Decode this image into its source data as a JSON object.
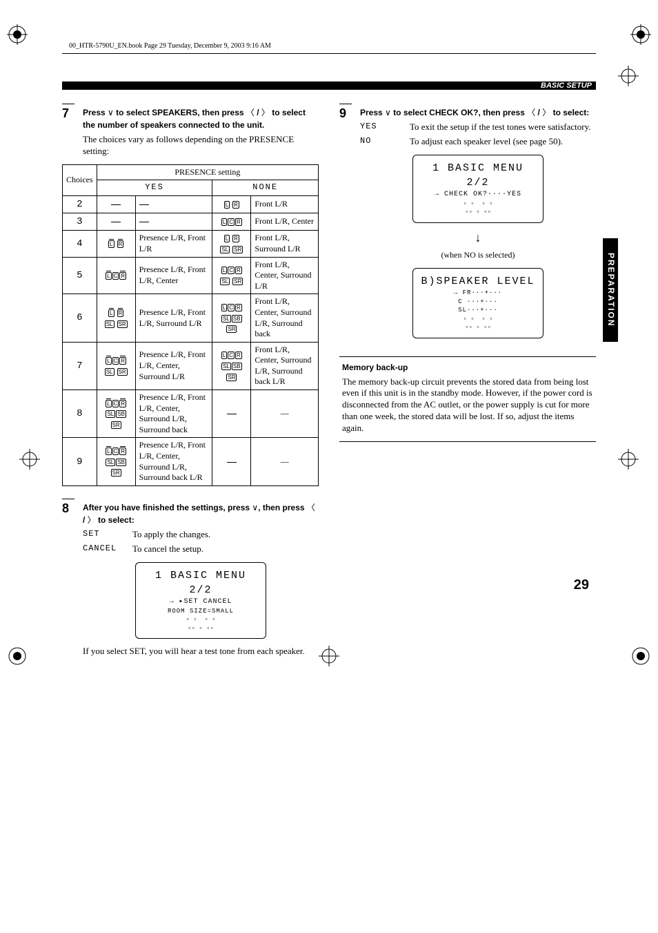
{
  "header": {
    "filepath": "00_HTR-5790U_EN.book  Page 29  Tuesday, December 9, 2003  9:16 AM",
    "section": "BASIC SETUP"
  },
  "step7": {
    "num": "7",
    "instr_parts": {
      "a": "Press ",
      "b": " to select SPEAKERS, then press ",
      "c": " / ",
      "d": " to select the number of speakers connected to the unit."
    },
    "desc": "The choices vary as follows depending on the PRESENCE setting:"
  },
  "table": {
    "head": {
      "choices": "Choices",
      "presence": "PRESENCE setting",
      "yes": "YES",
      "none": "NONE"
    },
    "rows": [
      {
        "choice": "2",
        "yes_desc": "",
        "none_desc": "Front L/R"
      },
      {
        "choice": "3",
        "yes_desc": "",
        "none_desc": "Front L/R, Center"
      },
      {
        "choice": "4",
        "yes_desc": "Presence L/R, Front L/R",
        "none_desc": "Front L/R, Surround L/R"
      },
      {
        "choice": "5",
        "yes_desc": "Presence L/R, Front L/R, Center",
        "none_desc": "Front L/R, Center, Surround L/R"
      },
      {
        "choice": "6",
        "yes_desc": "Presence L/R, Front L/R, Surround L/R",
        "none_desc": "Front L/R, Center, Surround L/R, Surround back"
      },
      {
        "choice": "7",
        "yes_desc": "Presence L/R, Front L/R, Center, Surround L/R",
        "none_desc": "Front L/R, Center, Surround L/R, Surround back L/R"
      },
      {
        "choice": "8",
        "yes_desc": "Presence L/R, Front L/R, Center, Surround L/R, Surround back",
        "none_desc": "—"
      },
      {
        "choice": "9",
        "yes_desc": "Presence L/R, Front L/R, Center, Surround L/R, Surround back L/R",
        "none_desc": "—"
      }
    ]
  },
  "step8": {
    "num": "8",
    "instr_parts": {
      "a": "After you have finished the settings, press ",
      "b": ", then press ",
      "c": " / ",
      "d": " to select:"
    },
    "options": {
      "set_key": "SET",
      "set_val": "To apply the changes.",
      "cancel_key": "CANCEL",
      "cancel_val": "To cancel the setup."
    },
    "lcd": {
      "title": "1 BASIC MENU 2/2",
      "row1": "→    ▸SET  CANCEL",
      "row2": "ROOM SIZE=SMALL"
    },
    "note": "If you select SET, you will hear a test tone from each speaker."
  },
  "step9": {
    "num": "9",
    "instr_parts": {
      "a": "Press ",
      "b": " to select CHECK OK?, then press ",
      "c": " / ",
      "d": " to select:"
    },
    "options": {
      "yes_key": "YES",
      "yes_val": "To exit the setup if the test tones were satisfactory.",
      "no_key": "NO",
      "no_val": "To adjust each speaker level (see page 50)."
    },
    "lcd1": {
      "title": "1 BASIC MENU 2/2",
      "row1": "→ CHECK OK?····YES"
    },
    "arrow_caption": "(when NO is selected)",
    "lcd2": {
      "title": "B)SPEAKER LEVEL",
      "row1": "→   FR···+···",
      "row2": "    C ···+···",
      "row3": "    SL···+···"
    }
  },
  "memory": {
    "title": "Memory back-up",
    "body": "The memory back-up circuit prevents the stored data from being lost even if this unit is in the standby mode. However, if the power cord is disconnected from the AC outlet, or the power supply is cut for more than one week, the stored data will be lost. If so, adjust the items again."
  },
  "sidebar": {
    "label": "PREPARATION"
  },
  "page_num": "29"
}
